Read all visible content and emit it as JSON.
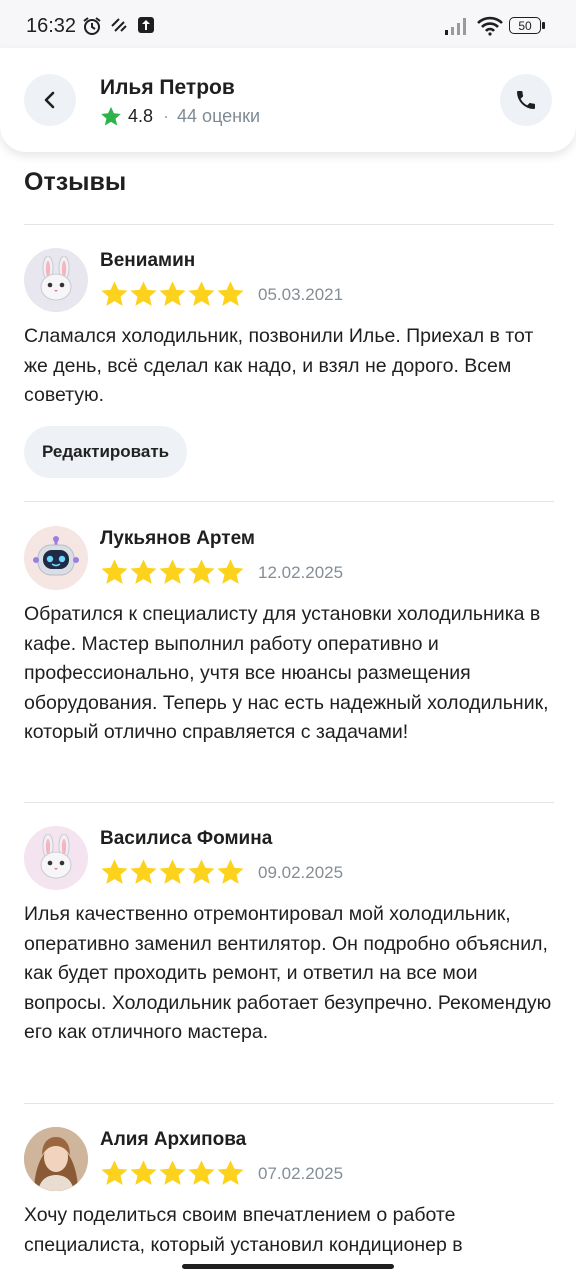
{
  "status_bar": {
    "time": "16:32",
    "battery": "50"
  },
  "header": {
    "name": "Илья Петров",
    "rating": "4.8",
    "separator": "·",
    "reviews_count": "44 оценки"
  },
  "section": {
    "title": "Отзывы"
  },
  "reviews": [
    {
      "author": "Вениамин",
      "rating": 5,
      "date": "05.03.2021",
      "text": "Сламался холодильник, позвонили Илье. Приехал в тот же день, всё сделал как надо, и взял не дорого. Всем советую.",
      "edit_label": "Редактировать",
      "avatar": "bunny"
    },
    {
      "author": "Лукьянов Артем",
      "rating": 5,
      "date": "12.02.2025",
      "text": "Обратился к специалисту для установки холодильника в кафе. Мастер выполнил работу оперативно и профессионально, учтя все нюансы размещения оборудования. Теперь у нас есть надежный холодильник, который отлично справляется с задачами!",
      "avatar": "robot"
    },
    {
      "author": "Василиса Фомина",
      "rating": 5,
      "date": "09.02.2025",
      "text": "Илья качественно отремонтировал мой холодильник, оперативно заменил вентилятор. Он подробно объяснил, как будет проходить ремонт, и ответил на все мои вопросы. Холодильник работает безупречно. Рекомендую его как отличного мастера.",
      "avatar": "bunny"
    },
    {
      "author": "Алия Архипова",
      "rating": 5,
      "date": "07.02.2025",
      "text": "Хочу поделиться своим впечатлением о работе специалиста, который установил кондиционер в",
      "avatar": "photo"
    }
  ],
  "colors": {
    "star": "#fcd21c",
    "rating_star": "#2db34a",
    "button_bg": "#eef2f6"
  }
}
